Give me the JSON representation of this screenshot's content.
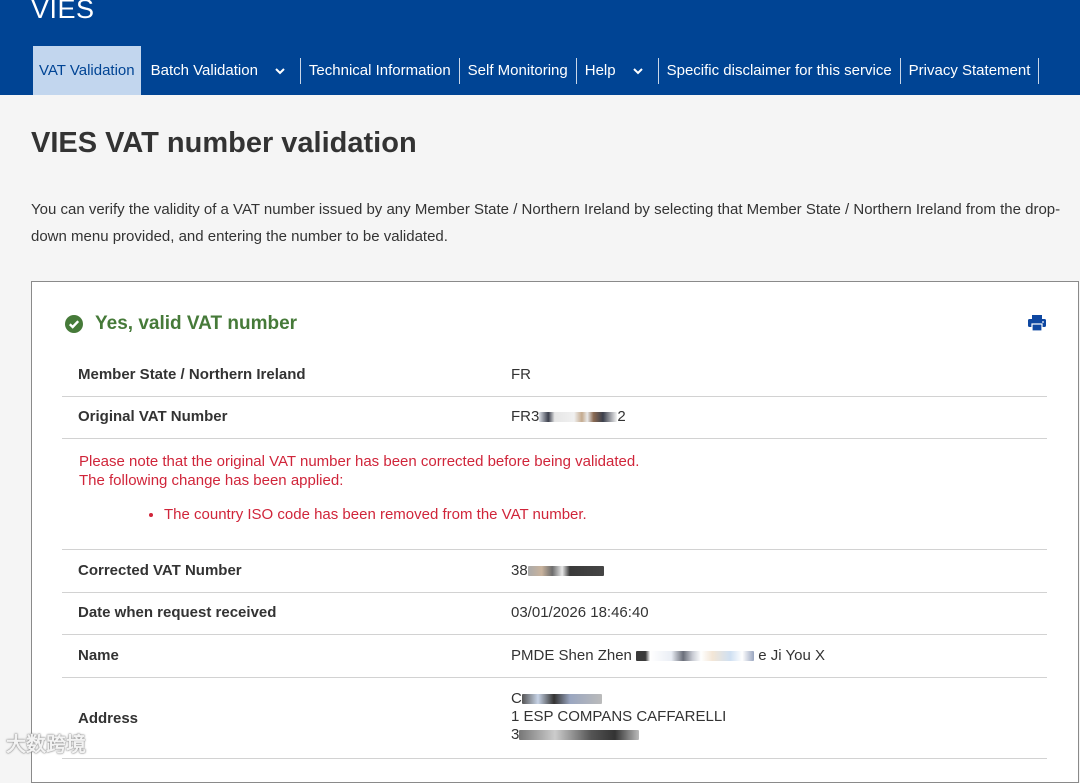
{
  "header": {
    "site_title": "VIES",
    "nav": [
      {
        "label": "VAT Validation",
        "active": true
      },
      {
        "label": "Batch Validation",
        "dropdown": true
      },
      {
        "label": "Technical Information"
      },
      {
        "label": "Self Monitoring"
      },
      {
        "label": "Help",
        "dropdown": true
      },
      {
        "label": "Specific disclaimer for this service"
      },
      {
        "label": "Privacy Statement"
      }
    ]
  },
  "main": {
    "title": "VIES VAT number validation",
    "intro": "You can verify the validity of a VAT number issued by any Member State / Northern Ireland by selecting that Member State / Northern Ireland from the drop-down menu provided, and entering the number to be validated."
  },
  "result": {
    "status": "Yes, valid VAT number",
    "rows": {
      "member_state": {
        "label": "Member State / Northern Ireland",
        "value": "FR"
      },
      "original_vat": {
        "label": "Original VAT Number",
        "value_prefix": "FR3",
        "value_suffix": "2"
      },
      "corrected_vat": {
        "label": "Corrected VAT Number",
        "value_prefix": "38"
      },
      "date": {
        "label": "Date when request received",
        "value": "03/01/2026 18:46:40"
      },
      "name": {
        "label": "Name",
        "value_prefix": "PMDE Shen Zhen",
        "value_suffix": "e Ji You X"
      },
      "address": {
        "label": "Address",
        "line1_prefix": "C",
        "line2": "1 ESP COMPANS CAFFARELLI",
        "line3_prefix": "3"
      }
    },
    "note": {
      "line1": "Please note that the original VAT number has been corrected before being validated.",
      "line2": "The following change has been applied:",
      "bullet": "The country ISO code has been removed from the VAT number."
    }
  },
  "watermark": "大数跨境",
  "colors": {
    "header_bg": "#004494",
    "active_tab_bg": "#c2d6ee",
    "valid_green": "#467a39",
    "note_red": "#d0253a"
  },
  "icons": {
    "status": "check-circle-icon",
    "print": "print-icon",
    "dropdown": "chevron-down-icon"
  }
}
